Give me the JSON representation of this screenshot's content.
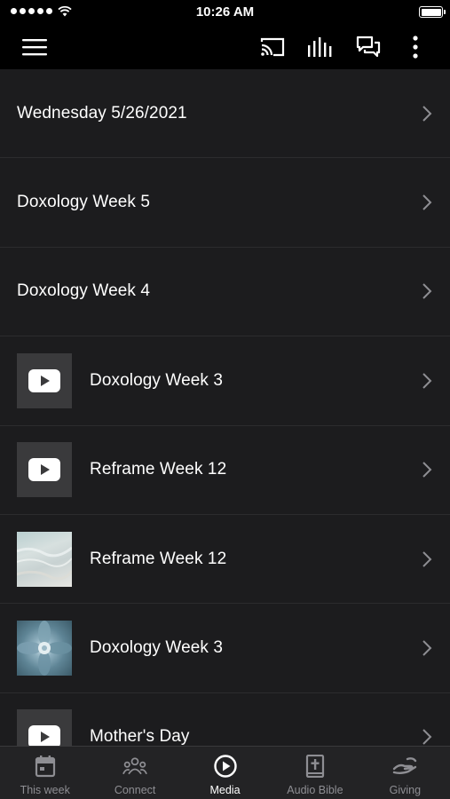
{
  "status_bar": {
    "time": "10:26 AM"
  },
  "header": {
    "icons": [
      "hamburger-menu-icon",
      "cast-icon",
      "equalizer-icon",
      "chat-icon",
      "more-vertical-icon"
    ]
  },
  "media_list": [
    {
      "title": "Wednesday 5/26/2021",
      "thumbnail": "none"
    },
    {
      "title": "Doxology Week 5",
      "thumbnail": "none"
    },
    {
      "title": "Doxology Week 4",
      "thumbnail": "none"
    },
    {
      "title": "Doxology Week 3",
      "thumbnail": "video-play-icon"
    },
    {
      "title": "Reframe Week 12",
      "thumbnail": "video-play-icon"
    },
    {
      "title": "Reframe Week 12",
      "thumbnail": "beach-photo"
    },
    {
      "title": "Doxology Week 3",
      "thumbnail": "succulent-photo"
    },
    {
      "title": "Mother's Day",
      "thumbnail": "video-play-icon"
    }
  ],
  "tab_bar": {
    "tabs": [
      {
        "label": "This week",
        "icon": "calendar-icon",
        "active": false
      },
      {
        "label": "Connect",
        "icon": "people-icon",
        "active": false
      },
      {
        "label": "Media",
        "icon": "play-circle-icon",
        "active": true
      },
      {
        "label": "Audio Bible",
        "icon": "bible-icon",
        "active": false
      },
      {
        "label": "Giving",
        "icon": "giving-hand-icon",
        "active": false
      }
    ]
  },
  "colors": {
    "background": "#1c1c1e",
    "bar_background": "#000000",
    "tab_bar_background": "#232325",
    "separator": "#2c2c2e",
    "thumbnail_placeholder": "#3a3a3c",
    "inactive_tab": "#8e8e93",
    "text": "#ffffff"
  }
}
